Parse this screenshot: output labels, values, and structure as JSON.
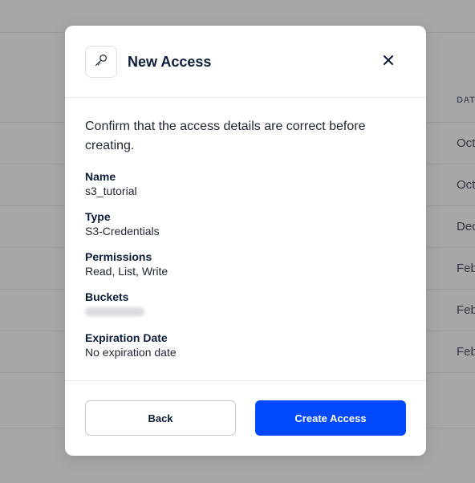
{
  "background": {
    "column_header": "DAT",
    "rows": [
      "Oct",
      "Oct",
      "Dec",
      "Feb",
      "Feb",
      "Feb"
    ]
  },
  "modal": {
    "title": "New Access",
    "icon": "key-icon",
    "close_icon": "close-icon",
    "intro": "Confirm that the access details are correct before creating.",
    "fields": [
      {
        "label": "Name",
        "value": "s3_tutorial"
      },
      {
        "label": "Type",
        "value": "S3-Credentials"
      },
      {
        "label": "Permissions",
        "value": "Read, List, Write"
      },
      {
        "label": "Buckets",
        "value": ""
      },
      {
        "label": "Expiration Date",
        "value": "No expiration date"
      }
    ],
    "back_label": "Back",
    "create_label": "Create Access"
  },
  "colors": {
    "primary": "#0149ff",
    "title": "#0b1b3a",
    "overlay": "#434548"
  }
}
